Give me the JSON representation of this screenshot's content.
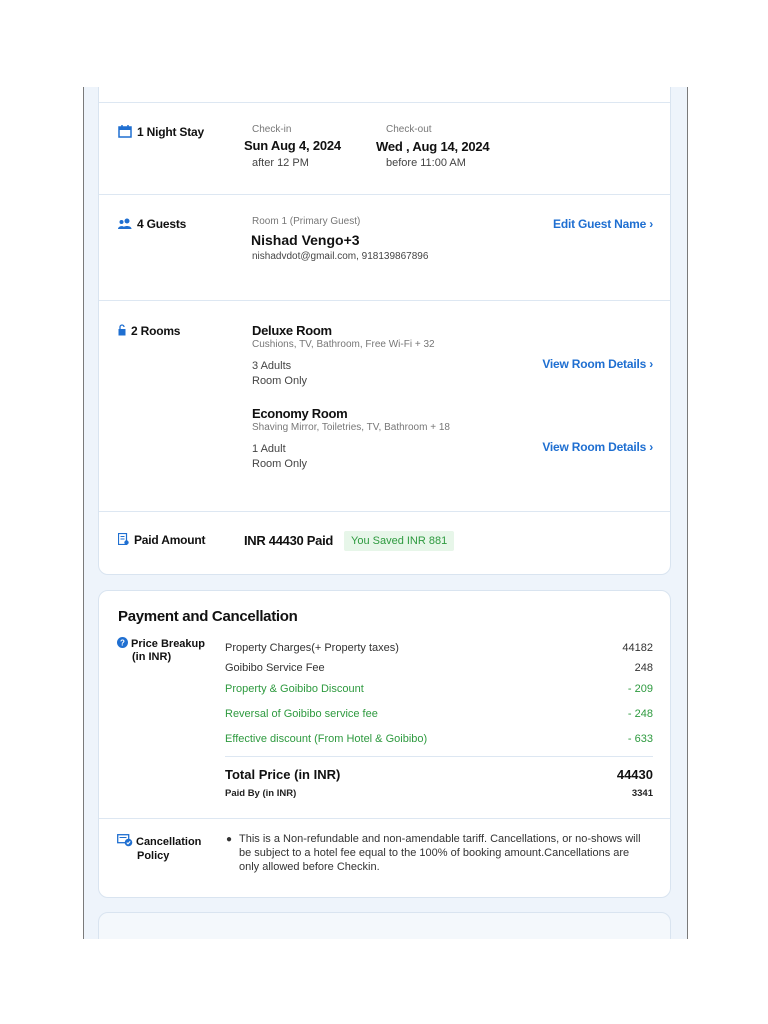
{
  "stay": {
    "label": "1 Night Stay",
    "checkin_label": "Check-in",
    "checkin_date": "Sun Aug 4, 2024",
    "checkin_time": "after 12 PM",
    "checkout_label": "Check-out",
    "checkout_date": "Wed , Aug 14, 2024",
    "checkout_time": "before 11:00 AM"
  },
  "guests": {
    "label": "4 Guests",
    "room_label": "Room 1 (Primary Guest)",
    "name": "Nishad Vengo+3",
    "contact": "nishadvdot@gmail.com, 918139867896",
    "edit_link": "Edit Guest Name ›"
  },
  "rooms": {
    "label": "2 Rooms",
    "items": [
      {
        "name": "Deluxe Room",
        "amenities": "Cushions, TV, Bathroom, Free Wi-Fi + 32",
        "occupancy": "3 Adults",
        "plan": "Room Only",
        "link": "View Room Details ›"
      },
      {
        "name": "Economy Room",
        "amenities": "Shaving Mirror, Toiletries, TV, Bathroom + 18",
        "occupancy": "1 Adult",
        "plan": "Room Only",
        "link": "View Room Details ›"
      }
    ]
  },
  "paid": {
    "label": "Paid Amount",
    "amount": "INR 44430 Paid",
    "saved": "You Saved INR 881"
  },
  "payment": {
    "title": "Payment and Cancellation",
    "breakup_label_1": "Price Breakup",
    "breakup_label_2": "(in INR)",
    "rows": [
      {
        "label": "Property Charges(+ Property taxes)",
        "value": "44182"
      },
      {
        "label": "Goibibo Service Fee",
        "value": "248"
      },
      {
        "label": "Property & Goibibo Discount",
        "value": "- 209"
      },
      {
        "label": "Reversal of Goibibo service fee",
        "value": "- 248"
      },
      {
        "label": "Effective discount (From Hotel & Goibibo)",
        "value": "- 633"
      }
    ],
    "total_label": "Total Price (in INR)",
    "total_value": "44430",
    "paid_by_label": "Paid By (in INR)",
    "paid_by_value": "3341",
    "cancellation_label_1": "Cancellation",
    "cancellation_label_2": "Policy",
    "cancellation_text": "This is a Non-refundable and non-amendable tariff. Cancellations, or no-shows will be subject to a hotel fee equal to the 100% of booking amount.Cancellations are only allowed before Checkin."
  },
  "colors": {
    "accent": "#1f6fd1",
    "discount": "#2e9a3f",
    "saved_bg": "#e7f6e9"
  },
  "icons": [
    "calendar-icon",
    "guests-icon",
    "room-key-icon",
    "receipt-icon",
    "info-icon",
    "cancellation-icon"
  ]
}
